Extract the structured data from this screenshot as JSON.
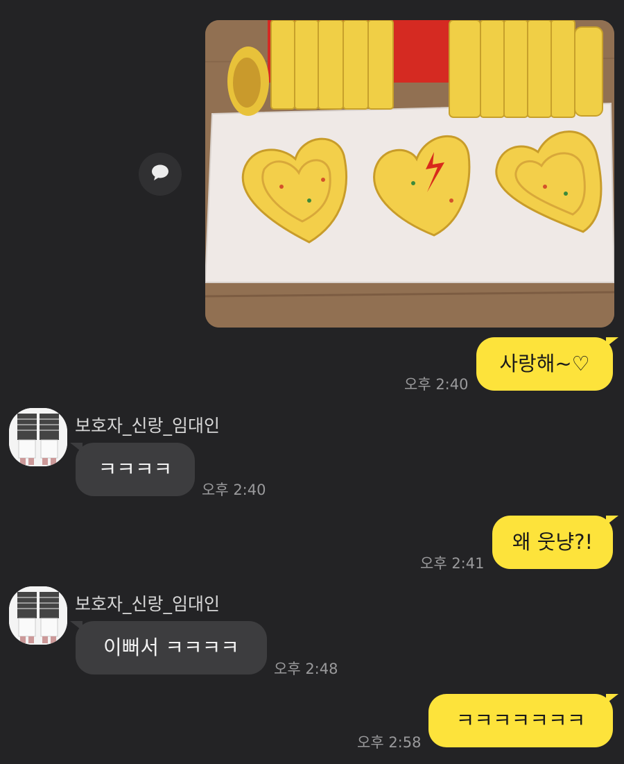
{
  "messages": [
    {
      "from": "me",
      "type": "photo",
      "icon": "speech-bubble-icon"
    },
    {
      "from": "me",
      "text": "사랑해~♡",
      "time": "오후 2:40"
    },
    {
      "from": "other",
      "sender": "보호자_신랑_임대인",
      "text": "ㅋㅋㅋㅋ",
      "time": "오후 2:40"
    },
    {
      "from": "me",
      "text": "왜 웃냥?!",
      "time": "오후 2:41"
    },
    {
      "from": "other",
      "sender": "보호자_신랑_임대인",
      "text": "이뻐서 ㅋㅋㅋㅋ",
      "time": "오후 2:48"
    },
    {
      "from": "me",
      "text": "ㅋㅋㅋㅋㅋㅋㅋ",
      "time": "오후 2:58"
    }
  ],
  "colors": {
    "background": "#232325",
    "my_bubble": "#fde33b",
    "their_bubble": "#3d3d3f",
    "time_text": "#9a9a9c"
  }
}
